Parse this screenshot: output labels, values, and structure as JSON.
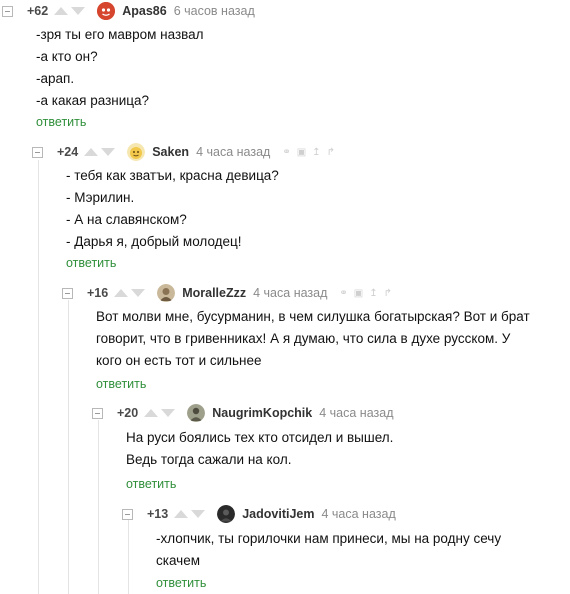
{
  "comments": [
    {
      "rating": "+62",
      "author": "Apas86",
      "time": "6 часов назад",
      "lines": [
        "-зря ты его мавром назвал",
        "-а кто он?",
        "-арап.",
        "-а какая разница?"
      ],
      "reply_label": "ответить",
      "avatar_color": "#d6462f"
    },
    {
      "rating": "+24",
      "author": "Saken",
      "time": "4 часа назад",
      "lines": [
        "- тебя как зватъи, красна девица?",
        "- Мэрилин.",
        "- А на славянском?",
        "- Дарья я, добрый молодец!"
      ],
      "reply_label": "ответить",
      "avatar_color": "#f2c84b"
    },
    {
      "rating": "+16",
      "author": "MoralleZzz",
      "time": "4 часа назад",
      "lines": [
        "Вот молви мне, бусурманин, в чем силушка богатырская? Вот и брат",
        "говорит, что в гривенниках! А я думаю, что сила в духе русском. У",
        "кого он есть тот и сильнее"
      ],
      "reply_label": "ответить",
      "avatar_color": "#8a7355"
    },
    {
      "rating": "+20",
      "author": "NaugrimKopchik",
      "time": "4 часа назад",
      "lines": [
        "На руси боялись тех кто отсидел и вышел.",
        "Ведь тогда сажали на кол."
      ],
      "reply_label": "ответить",
      "avatar_color": "#6b6b5c"
    },
    {
      "rating": "+13",
      "author": "JadovitiJem",
      "time": "4 часа назад",
      "lines": [
        "-хлопчик, ты горилочки нам принеси, мы на родну сечу",
        "скачем"
      ],
      "reply_label": "ответить",
      "avatar_color": "#2a2a2a"
    }
  ],
  "colors": {
    "reply_link": "#2f8f3a",
    "rating": "#4a4a4a",
    "time": "#8a8a8a",
    "arrow": "#d9d9d9"
  },
  "icons": [
    "collapse-icon",
    "upvote-icon",
    "downvote-icon",
    "link-icon",
    "save-icon",
    "arrow-up-icon",
    "branch-icon"
  ]
}
